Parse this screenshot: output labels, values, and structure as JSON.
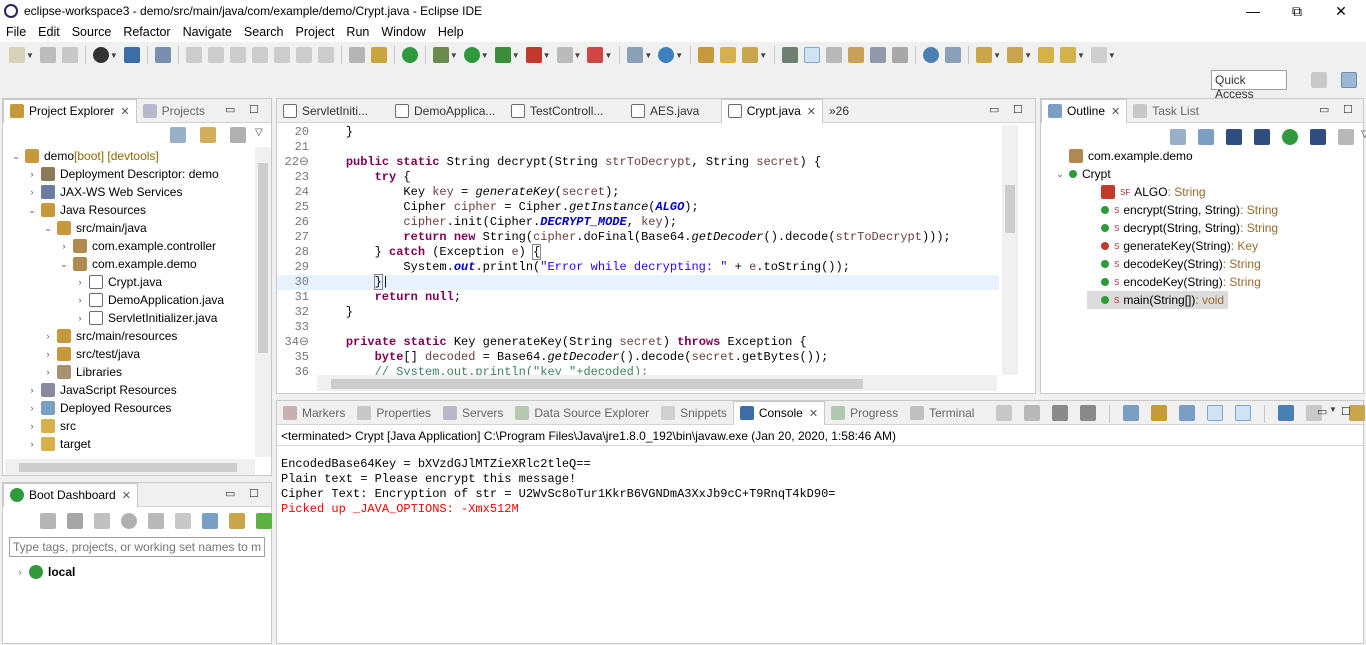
{
  "window": {
    "title": "eclipse-workspace3 - demo/src/main/java/com/example/demo/Crypt.java - Eclipse IDE",
    "minimize": "—",
    "restore": "⧉",
    "close": "✕"
  },
  "menu": [
    "File",
    "Edit",
    "Source",
    "Refactor",
    "Navigate",
    "Search",
    "Project",
    "Run",
    "Window",
    "Help"
  ],
  "quick_access": "Quick Access",
  "project_explorer": {
    "tab_label": "Project Explorer",
    "tab2_label": "Projects",
    "tree": [
      {
        "label": "demo",
        "deco": " [boot] [devtools]",
        "level": 0,
        "twisty": "⌄",
        "icon": "project-icon"
      },
      {
        "label": "Deployment Descriptor: demo",
        "level": 1,
        "twisty": "›",
        "icon": "deployment-descriptor-icon"
      },
      {
        "label": "JAX-WS Web Services",
        "level": 1,
        "twisty": "›",
        "icon": "web-services-icon"
      },
      {
        "label": "Java Resources",
        "level": 1,
        "twisty": "⌄",
        "icon": "java-resources-icon"
      },
      {
        "label": "src/main/java",
        "level": 2,
        "twisty": "⌄",
        "icon": "source-folder-icon"
      },
      {
        "label": "com.example.controller",
        "level": 3,
        "twisty": "›",
        "icon": "package-icon"
      },
      {
        "label": "com.example.demo",
        "level": 3,
        "twisty": "⌄",
        "icon": "package-icon"
      },
      {
        "label": "Crypt.java",
        "level": 4,
        "twisty": "›",
        "icon": "java-file-icon"
      },
      {
        "label": "DemoApplication.java",
        "level": 4,
        "twisty": "›",
        "icon": "java-file-icon"
      },
      {
        "label": "ServletInitializer.java",
        "level": 4,
        "twisty": "›",
        "icon": "java-file-icon"
      },
      {
        "label": "src/main/resources",
        "level": 2,
        "twisty": "›",
        "icon": "source-folder-icon"
      },
      {
        "label": "src/test/java",
        "level": 2,
        "twisty": "›",
        "icon": "source-folder-icon"
      },
      {
        "label": "Libraries",
        "level": 2,
        "twisty": "›",
        "icon": "libraries-icon"
      },
      {
        "label": "JavaScript Resources",
        "level": 1,
        "twisty": "›",
        "icon": "javascript-resources-icon"
      },
      {
        "label": "Deployed Resources",
        "level": 1,
        "twisty": "›",
        "icon": "deployed-resources-icon"
      },
      {
        "label": "src",
        "level": 1,
        "twisty": "›",
        "icon": "folder-icon"
      },
      {
        "label": "target",
        "level": 1,
        "twisty": "›",
        "icon": "folder-icon"
      }
    ]
  },
  "boot_dashboard": {
    "tab_label": "Boot Dashboard",
    "filter_placeholder": "Type tags, projects, or working set names to match",
    "local_label": "local"
  },
  "editor": {
    "tabs": [
      "ServletIniti...",
      "DemoApplica...",
      "TestControll...",
      "AES.java",
      "Crypt.java"
    ],
    "active_tab": "Crypt.java",
    "overflow": "»26",
    "lines": [
      {
        "n": "20",
        "html": "    }"
      },
      {
        "n": "21",
        "html": ""
      },
      {
        "n": "22⊖",
        "html": "    <span class=\"kw\">public</span> <span class=\"kw\">static</span> String decrypt(String <span class=\"var\">strToDecrypt</span>, String <span class=\"var\">secret</span>) {"
      },
      {
        "n": "23",
        "html": "        <span class=\"kw\">try</span> {"
      },
      {
        "n": "24",
        "html": "            Key <span class=\"var\">key</span> = <span class=\"it\">generateKey</span>(<span class=\"var\">secret</span>);"
      },
      {
        "n": "25",
        "html": "            Cipher <span class=\"var\">cipher</span> = Cipher.<span class=\"it\">getInstance</span>(<span class=\"fld\">ALGO</span>);"
      },
      {
        "n": "26",
        "html": "            <span class=\"var\">cipher</span>.init(Cipher.<span class=\"fld\">DECRYPT_MODE</span>, <span class=\"var\">key</span>);"
      },
      {
        "n": "27",
        "html": "            <span class=\"kw\">return</span> <span class=\"kw\">new</span> String(<span class=\"var\">cipher</span>.doFinal(Base64.<span class=\"it\">getDecoder</span>().decode(<span class=\"var\">strToDecrypt</span>)));"
      },
      {
        "n": "28",
        "html": "        } <span class=\"kw\">catch</span> (Exception <span class=\"var\">e</span>) <span style=\"outline:1px solid #888\">{</span>"
      },
      {
        "n": "29",
        "html": "            System.<span class=\"fld\">out</span>.println(<span class=\"str\">\"Error while decrypting: \"</span> + <span class=\"var\">e</span>.toString());"
      },
      {
        "n": "30",
        "html": "        <span style=\"outline:1px solid #888\">}</span>|"
      },
      {
        "n": "31",
        "html": "        <span class=\"kw\">return</span> <span class=\"kw\">null</span>;"
      },
      {
        "n": "32",
        "html": "    }"
      },
      {
        "n": "33",
        "html": ""
      },
      {
        "n": "34⊖",
        "html": "    <span class=\"kw\">private</span> <span class=\"kw\">static</span> Key generateKey(String <span class=\"var\">secret</span>) <span class=\"kw\">throws</span> Exception {"
      },
      {
        "n": "35",
        "html": "        <span class=\"kw\">byte</span>[] <span class=\"var\">decoded</span> = Base64.<span class=\"it\">getDecoder</span>().decode(<span class=\"var\">secret</span>.getBytes());"
      },
      {
        "n": "36",
        "html": "        <span class=\"cm\">// System.out.println(\"key \"+decoded);</span>"
      }
    ]
  },
  "outline": {
    "tab_label": "Outline",
    "tab2_label": "Task List",
    "items": [
      {
        "label": "com.example.demo",
        "type": "",
        "level": 0,
        "icon": "package-icon",
        "twisty": ""
      },
      {
        "label": "Crypt",
        "type": "",
        "level": 0,
        "icon": "class-icon",
        "twisty": "⌄"
      },
      {
        "label": "ALGO",
        "type": " : String",
        "level": 1,
        "icon": "private-field-icon",
        "twisty": "",
        "mod": "SF"
      },
      {
        "label": "encrypt(String, String)",
        "type": " : String",
        "level": 1,
        "icon": "public-method-icon",
        "twisty": "",
        "mod": "S"
      },
      {
        "label": "decrypt(String, String)",
        "type": " : String",
        "level": 1,
        "icon": "public-method-icon",
        "twisty": "",
        "mod": "S"
      },
      {
        "label": "generateKey(String)",
        "type": " : Key",
        "level": 1,
        "icon": "private-method-icon",
        "twisty": "",
        "mod": "S"
      },
      {
        "label": "decodeKey(String)",
        "type": " : String",
        "level": 1,
        "icon": "public-method-icon",
        "twisty": "",
        "mod": "S"
      },
      {
        "label": "encodeKey(String)",
        "type": " : String",
        "level": 1,
        "icon": "public-method-icon",
        "twisty": "",
        "mod": "S"
      },
      {
        "label": "main(String[])",
        "type": " : void",
        "level": 1,
        "icon": "public-method-icon",
        "twisty": "",
        "mod": "S",
        "selected": true
      }
    ]
  },
  "bottom": {
    "tabs": [
      "Markers",
      "Properties",
      "Servers",
      "Data Source Explorer",
      "Snippets",
      "Console",
      "Progress",
      "Terminal"
    ],
    "active": "Console",
    "terminated": "<terminated> Crypt [Java Application] C:\\Program Files\\Java\\jre1.8.0_192\\bin\\javaw.exe (Jan 20, 2020, 1:58:46 AM)",
    "output": [
      {
        "text": "EncodedBase64Key = bXVzdGJlMTZieXRlc2tleQ==",
        "color": "#000000"
      },
      {
        "text": "Plain text = Please encrypt this message!",
        "color": "#000000"
      },
      {
        "text": "Cipher Text: Encryption of str = U2WvSc8oTur1KkrB6VGNDmA3XxJb9cC+T9RnqT4kD90=",
        "color": "#000000"
      },
      {
        "text": "Picked up _JAVA_OPTIONS: -Xmx512M",
        "color": "#ff0000"
      }
    ]
  }
}
